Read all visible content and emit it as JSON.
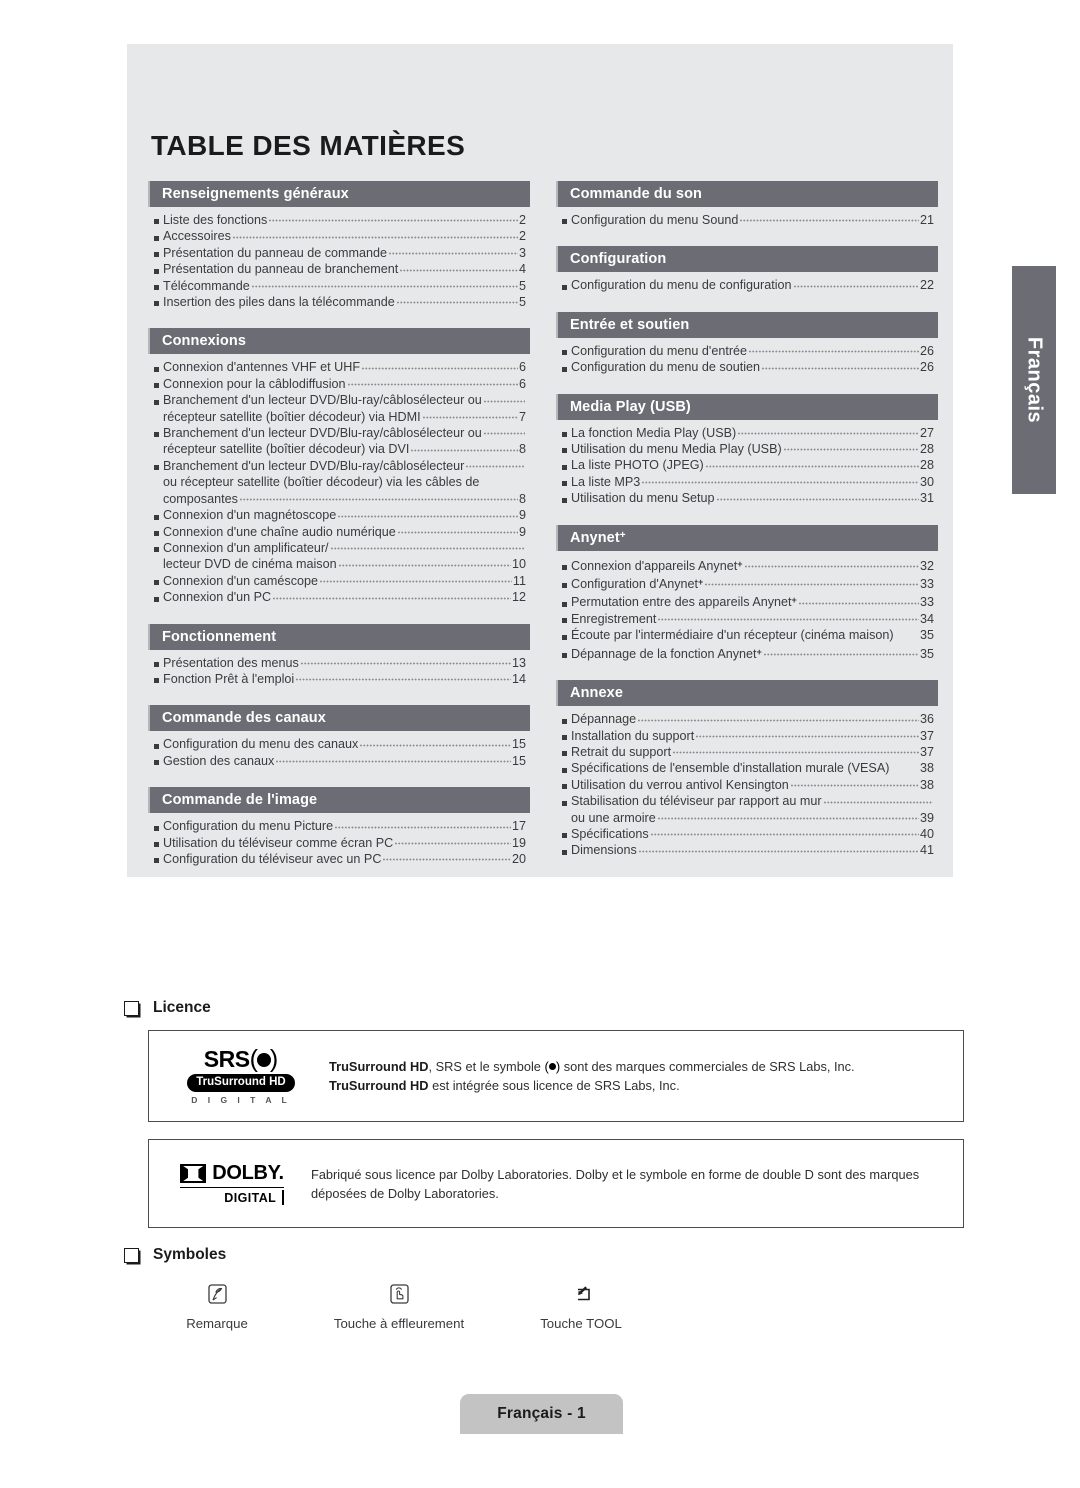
{
  "page_title": "TABLE DES MATIÈRES",
  "side_tab": {
    "label": "Français"
  },
  "footer": {
    "label": "Français - 1"
  },
  "toc": {
    "left_sections": [
      {
        "heading": "Renseignements généraux",
        "entries": [
          {
            "text": "Liste des fonctions",
            "page": "2"
          },
          {
            "text": "Accessoires",
            "page": "2"
          },
          {
            "text": "Présentation du panneau de commande",
            "page": "3"
          },
          {
            "text": "Présentation du panneau de branchement",
            "page": "4"
          },
          {
            "text": "Télécommande",
            "page": "5"
          },
          {
            "text": "Insertion des piles dans la télécommande",
            "page": "5"
          }
        ]
      },
      {
        "heading": "Connexions",
        "entries": [
          {
            "text": "Connexion d'antennes VHF et UHF",
            "page": "6"
          },
          {
            "text": "Connexion pour la câblodiffusion",
            "page": "6"
          },
          {
            "text": "Branchement d'un lecteur DVD/Blu-ray/câblosélecteur ou",
            "page": "",
            "cont": [
              {
                "text": "récepteur satellite (boîtier décodeur) via HDMI",
                "page": "7"
              }
            ]
          },
          {
            "text": "Branchement d'un lecteur DVD/Blu-ray/câblosélecteur ou",
            "page": "",
            "cont": [
              {
                "text": "récepteur satellite (boîtier décodeur) via DVI",
                "page": "8"
              }
            ]
          },
          {
            "text": "Branchement d'un lecteur DVD/Blu-ray/câblosélecteur",
            "page": "",
            "cont": [
              {
                "text": "ou récepteur satellite (boîtier décodeur) via les câbles de",
                "page": ""
              },
              {
                "text": "composantes",
                "page": "8"
              }
            ]
          },
          {
            "text": "Connexion d'un magnétoscope",
            "page": "9"
          },
          {
            "text": "Connexion d'une chaîne audio numérique",
            "page": "9"
          },
          {
            "text": "Connexion d'un amplificateur/",
            "page": "",
            "cont": [
              {
                "text": "lecteur DVD de cinéma maison",
                "page": "10"
              }
            ]
          },
          {
            "text": "Connexion d'un caméscope",
            "page": "11"
          },
          {
            "text": "Connexion d'un PC",
            "page": "12"
          }
        ]
      },
      {
        "heading": "Fonctionnement",
        "entries": [
          {
            "text": "Présentation des menus",
            "page": "13"
          },
          {
            "text": "Fonction Prêt à l'emploi",
            "page": "14"
          }
        ]
      },
      {
        "heading": "Commande des canaux",
        "entries": [
          {
            "text": "Configuration du menu des canaux",
            "page": "15"
          },
          {
            "text": "Gestion des canaux",
            "page": "15"
          }
        ]
      },
      {
        "heading": "Commande de l'image",
        "entries": [
          {
            "text": "Configuration du menu Picture",
            "page": "17"
          },
          {
            "text": "Utilisation du téléviseur comme écran PC",
            "page": "19"
          },
          {
            "text": "Configuration du téléviseur avec un PC",
            "page": "20"
          }
        ]
      }
    ],
    "right_sections": [
      {
        "heading": "Commande du son",
        "entries": [
          {
            "text": "Configuration du menu Sound",
            "page": "21"
          }
        ]
      },
      {
        "heading": "Configuration",
        "entries": [
          {
            "text": "Configuration du menu de configuration",
            "page": "22"
          }
        ]
      },
      {
        "heading": "Entrée et soutien",
        "entries": [
          {
            "text": "Configuration du menu d'entrée",
            "page": "26"
          },
          {
            "text": "Configuration du menu de soutien",
            "page": "26"
          }
        ]
      },
      {
        "heading": "Media Play (USB)",
        "entries": [
          {
            "text": "La fonction Media Play (USB)",
            "page": "27"
          },
          {
            "text": "Utilisation du menu Media Play (USB)",
            "page": "28"
          },
          {
            "text": "La liste PHOTO (JPEG)",
            "page": "28"
          },
          {
            "text": "La liste MP3",
            "page": "30"
          },
          {
            "text": "Utilisation du menu Setup",
            "page": "31"
          }
        ]
      },
      {
        "heading": "Anynet",
        "heading_sup": "+",
        "entries": [
          {
            "text": "Connexion d'appareils Anynet",
            "sup": "+",
            "page": "32"
          },
          {
            "text": "Configuration d'Anynet",
            "sup": "+",
            "page": "33"
          },
          {
            "text": "Permutation entre des appareils Anynet",
            "sup": "+",
            "page": "33"
          },
          {
            "text": "Enregistrement",
            "page": "34"
          },
          {
            "text": "Écoute par l'intermédiaire d'un récepteur (cinéma maison)",
            "page": "35",
            "noleader": true
          },
          {
            "text": "Dépannage de la fonction Anynet",
            "sup": "+",
            "page": "35"
          }
        ]
      },
      {
        "heading": "Annexe",
        "entries": [
          {
            "text": "Dépannage",
            "page": "36"
          },
          {
            "text": "Installation du support",
            "page": "37"
          },
          {
            "text": "Retrait du support",
            "page": "37"
          },
          {
            "text": "Spécifications de l'ensemble d'installation murale (VESA)",
            "page": "38",
            "noleader": true
          },
          {
            "text": "Utilisation du verrou antivol Kensington",
            "page": "38"
          },
          {
            "text": "Stabilisation du téléviseur par rapport au mur",
            "page": "",
            "cont": [
              {
                "text": "ou une armoire",
                "page": "39"
              }
            ]
          },
          {
            "text": "Spécifications",
            "page": "40"
          },
          {
            "text": "Dimensions",
            "page": "41"
          }
        ]
      }
    ]
  },
  "licence": {
    "heading": "Licence",
    "srs": {
      "logo_word": "SRS",
      "logo_pill": "TruSurround HD",
      "logo_digital": "D I G I T A L",
      "line1_bold": "TruSurround HD",
      "line1_mid": ", SRS et le symbole ",
      "line1_end": " sont des marques commerciales de SRS Labs, Inc.",
      "line2_bold": "TruSurround HD",
      "line2_rest": " est intégrée sous licence de SRS Labs, Inc."
    },
    "dolby": {
      "logo_word": "DOLBY.",
      "logo_sub": "DIGITAL",
      "text": "Fabriqué sous licence par Dolby Laboratories. Dolby et le symbole en forme de double D sont des marques déposées de Dolby Laboratories."
    }
  },
  "symboles": {
    "heading": "Symboles",
    "items": [
      {
        "icon": "note-pencil-icon",
        "label": "Remarque"
      },
      {
        "icon": "touch-hand-icon",
        "label": "Touche à effleurement"
      },
      {
        "icon": "tool-arrow-icon",
        "label": "Touche TOOL"
      }
    ]
  },
  "colors": {
    "panel_bg": "#e7e8ea",
    "section_bar": "#6c6c75",
    "footer_tab": "#c3c3c3",
    "text": "#3b3b3f"
  }
}
